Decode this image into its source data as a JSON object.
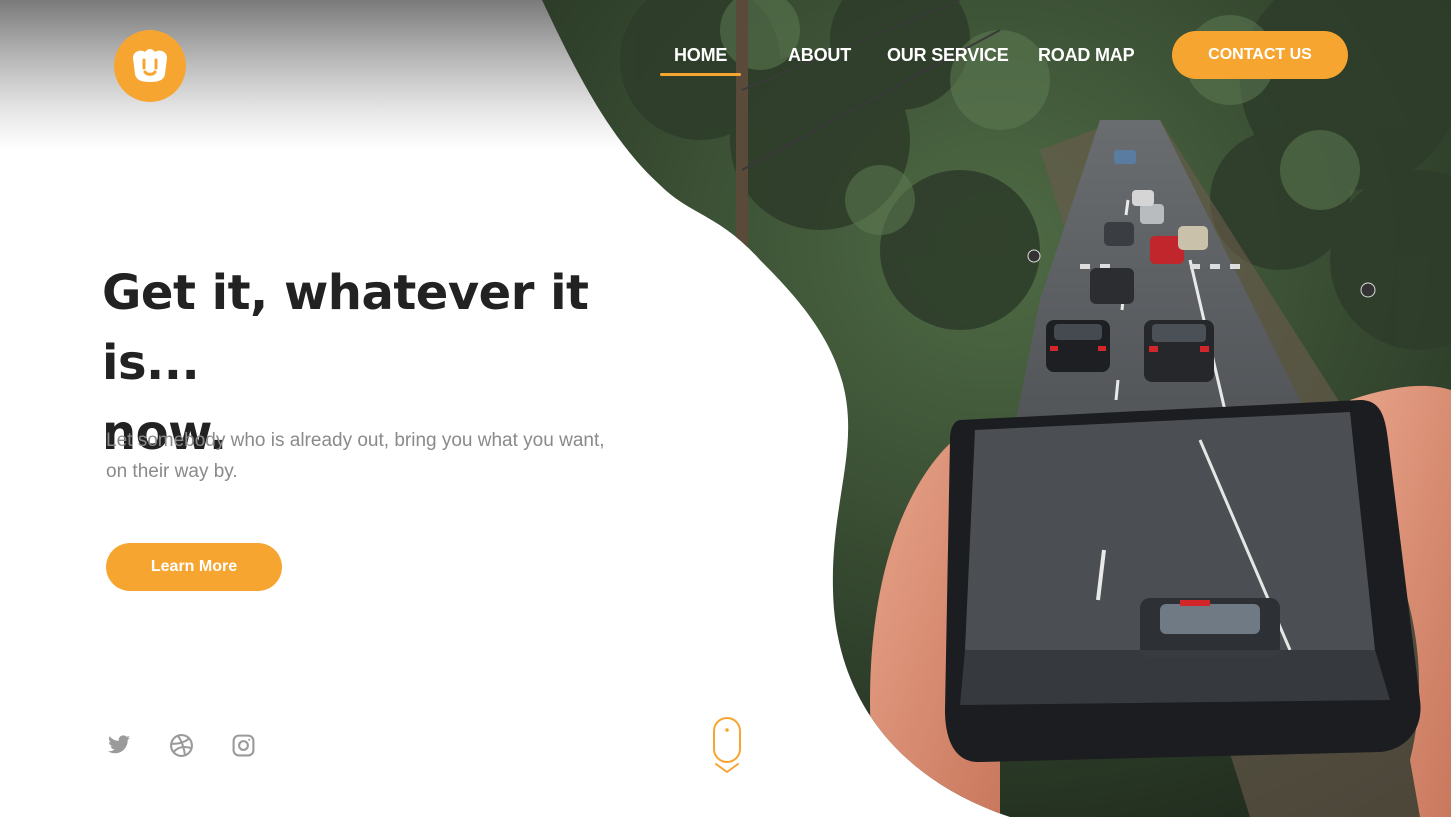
{
  "brand": {
    "logo_icon": "shopping-bag-logo",
    "accent_color": "#f7a531"
  },
  "nav": {
    "items": [
      {
        "label": "HOME",
        "active": true
      },
      {
        "label": "ABOUT",
        "active": false
      },
      {
        "label": "OUR SERVICE",
        "active": false
      },
      {
        "label": "ROAD MAP",
        "active": false
      }
    ],
    "contact_label": "CONTACT US"
  },
  "hero": {
    "headline_line1": "Get it, whatever it is...",
    "headline_line2": "now.",
    "subtext": "Let somebody who is already out, bring you what you want, on their way by.",
    "cta_label": "Learn More",
    "image_subject": "hand holding phone with road and cars emerging from screen"
  },
  "social": [
    {
      "icon": "twitter-icon"
    },
    {
      "icon": "dribbble-icon"
    },
    {
      "icon": "instagram-icon"
    }
  ],
  "scroll_indicator": {
    "icon": "mouse-scroll-icon"
  }
}
